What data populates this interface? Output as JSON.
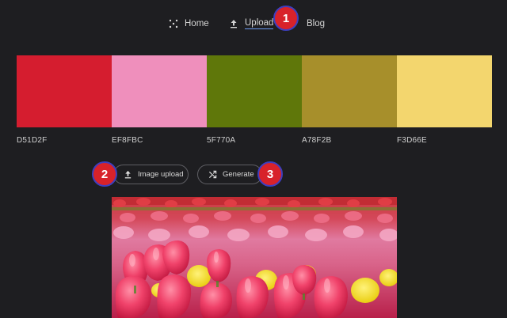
{
  "nav": {
    "items": [
      {
        "label": "Home",
        "icon": "dots-icon"
      },
      {
        "label": "Upload",
        "icon": "upload-icon",
        "active": true
      },
      {
        "label": "Blog"
      }
    ],
    "active_underline_color": "#6d9df5"
  },
  "badges": [
    "1",
    "2",
    "3"
  ],
  "palette": {
    "swatches": [
      {
        "color": "#D51D2F",
        "hex": "D51D2F"
      },
      {
        "color": "#EF8FBC",
        "hex": "EF8FBC"
      },
      {
        "color": "#5F770A",
        "hex": "5F770A"
      },
      {
        "color": "#A78F2B",
        "hex": "A78F2B"
      },
      {
        "color": "#F3D66E",
        "hex": "F3D66E"
      }
    ]
  },
  "actions": {
    "image_upload_label": "Image upload",
    "generate_label": "Generate"
  },
  "preview": {
    "subject": "tulip field photo",
    "image_icon": "photo-image"
  },
  "colors": {
    "background": "#1e1e21",
    "badge_fill": "#d8222a",
    "badge_border": "#3d3fbf"
  }
}
